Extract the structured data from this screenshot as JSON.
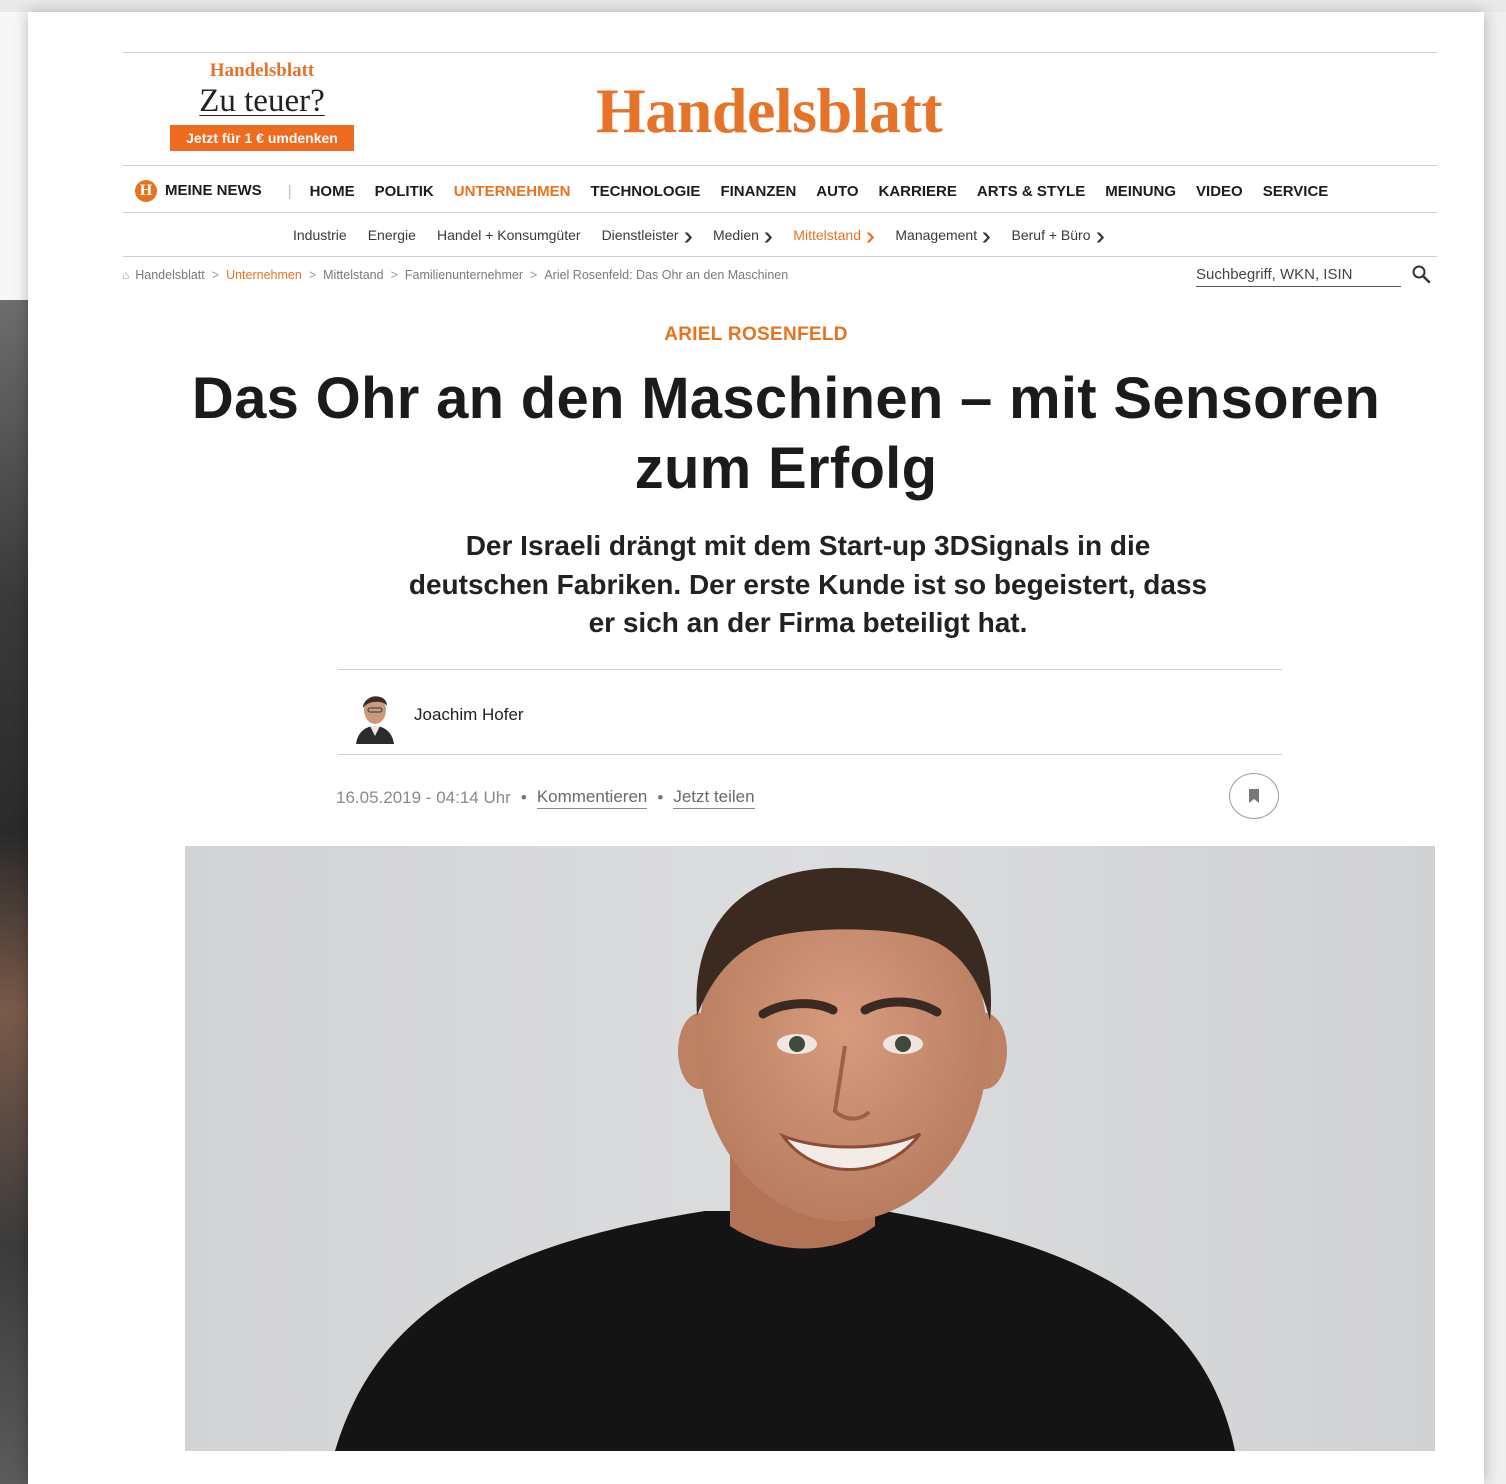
{
  "promo": {
    "brand": "Handelsblatt",
    "question": "Zu teuer?",
    "cta": "Jetzt für 1 € umdenken"
  },
  "logo": "Handelsblatt",
  "main_nav": {
    "meine_news": "MEINE NEWS",
    "items": [
      "HOME",
      "POLITIK",
      "UNTERNEHMEN",
      "TECHNOLOGIE",
      "FINANZEN",
      "AUTO",
      "KARRIERE",
      "ARTS & STYLE",
      "MEINUNG",
      "VIDEO",
      "SERVICE"
    ],
    "active": "UNTERNEHMEN"
  },
  "sub_nav": {
    "items": [
      "Industrie",
      "Energie",
      "Handel + Konsumgüter",
      "Dienstleister",
      "Medien",
      "Mittelstand",
      "Management",
      "Beruf + Büro"
    ],
    "active": "Mittelstand"
  },
  "breadcrumb": [
    "Handelsblatt",
    "Unternehmen",
    "Mittelstand",
    "Familienunternehmer",
    "Ariel Rosenfeld: Das Ohr an den Maschinen"
  ],
  "search": {
    "placeholder": "Suchbegriff, WKN, ISIN"
  },
  "article": {
    "kicker": "ARIEL ROSENFELD",
    "headline_line1": "Das Ohr an den Maschinen – mit Sensoren",
    "headline_line2": "zum Erfolg",
    "lead_line1": "Der Israeli drängt mit dem Start-up 3DSignals in die",
    "lead_line2": "deutschen Fabriken. Der erste Kunde ist so begeistert, dass",
    "lead_line3": "er sich an der Firma beteiligt hat.",
    "author": "Joachim Hofer",
    "date": "16.05.2019 - 04:14 Uhr",
    "comment_link": "Kommentieren",
    "share_link": "Jetzt teilen"
  },
  "colors": {
    "accent": "#e8731f",
    "text": "#1f1f1f",
    "rule": "#cfcfcf"
  }
}
